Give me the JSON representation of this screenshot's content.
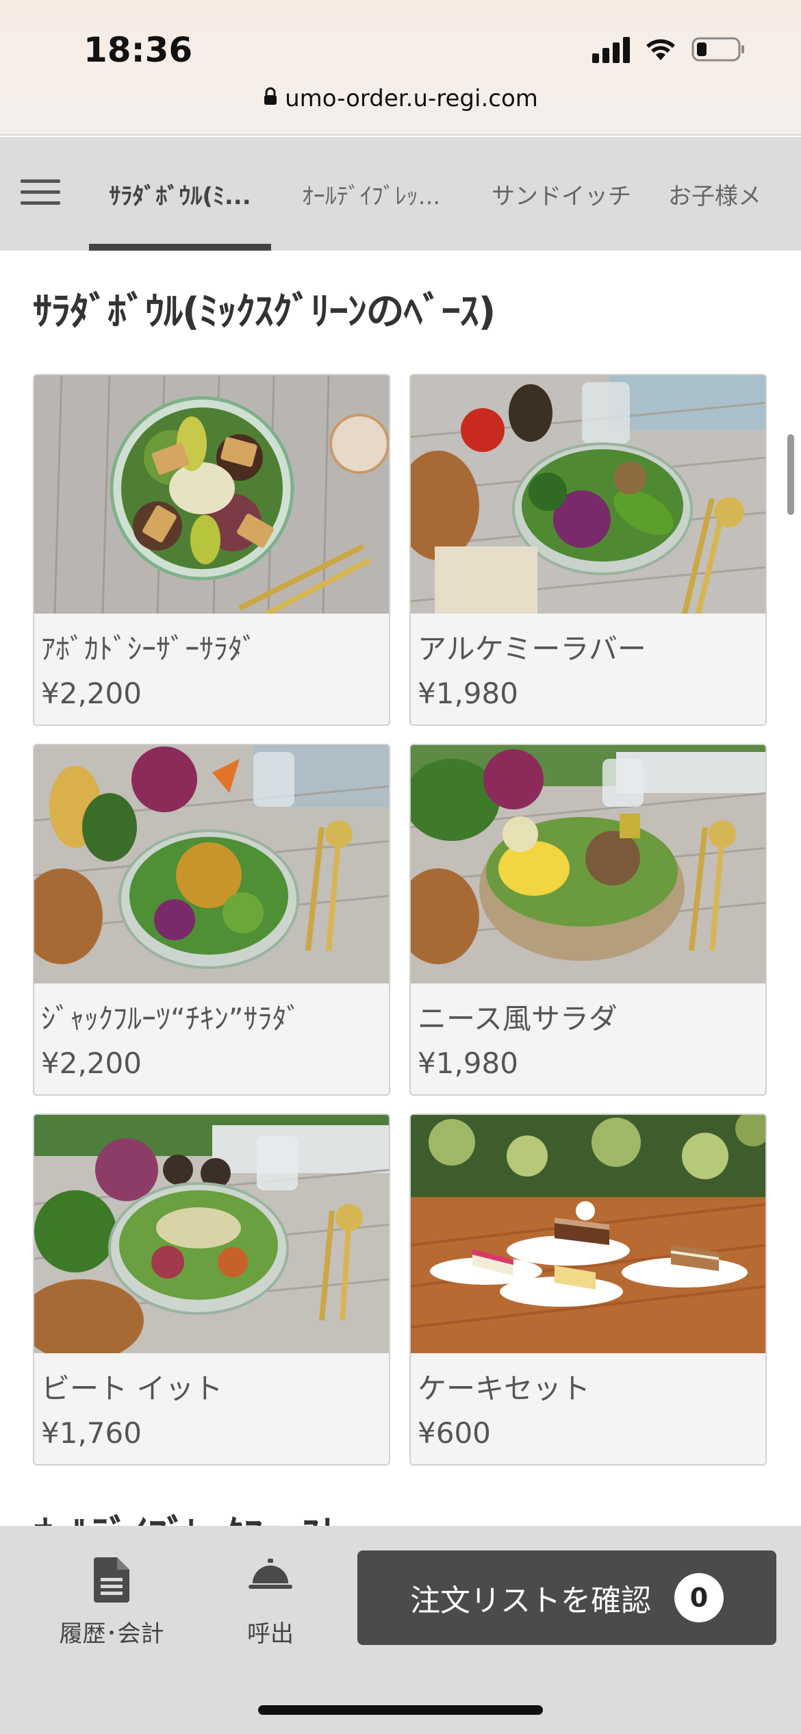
{
  "status_bar": {
    "time": "18:36",
    "url": "umo-order.u-regi.com",
    "icons": [
      "signal-icon",
      "wifi-icon",
      "battery-icon"
    ]
  },
  "category_nav": {
    "menu_icon": "hamburger-icon",
    "tabs": [
      {
        "label": "ｻﾗﾀﾞﾎﾞｳﾙ(ﾐ...",
        "active": true
      },
      {
        "label": "ｵｰﾙﾃﾞｲﾌﾞﾚｯ...",
        "active": false
      },
      {
        "label": "サンドイッチ",
        "active": false
      },
      {
        "label": "お子様メ",
        "active": false
      }
    ]
  },
  "section": {
    "title": "ｻﾗﾀﾞﾎﾞｳﾙ(ﾐｯｸｽｸﾞﾘｰﾝのﾍﾞｰｽ)",
    "next_title": "ｵｰﾙﾃﾞｲﾌﾞﾚｯｸﾌｧｰｽﾄ"
  },
  "products": [
    {
      "name": "ｱﾎﾞｶﾄﾞｼｰｻﾞｰｻﾗﾀﾞ",
      "price": "¥2,200"
    },
    {
      "name": "アルケミーラバー",
      "price": "¥1,980"
    },
    {
      "name": "ｼﾞｬｯｸﾌﾙｰﾂ“ﾁｷﾝ”ｻﾗﾀﾞ",
      "price": "¥2,200"
    },
    {
      "name": "ニース風サラダ",
      "price": "¥1,980"
    },
    {
      "name": "ビート イット",
      "price": "¥1,760"
    },
    {
      "name": "ケーキセット",
      "price": "¥600"
    }
  ],
  "bottom_bar": {
    "history_label": "履歴･会計",
    "call_label": "呼出",
    "order_button_label": "注文リストを確認",
    "order_count": "0"
  },
  "colors": {
    "nav_bg": "#dcdcdc",
    "button_bg": "#4b4b4b",
    "text": "#555555"
  }
}
